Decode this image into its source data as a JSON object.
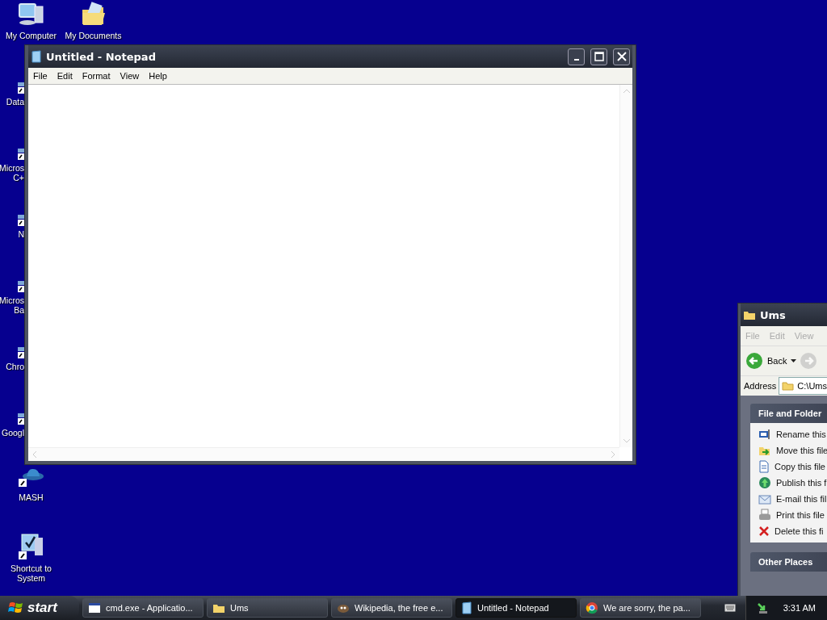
{
  "desktop": {
    "top_icons": [
      {
        "label": "My Computer",
        "kind": "computer"
      },
      {
        "label": "My Documents",
        "kind": "documents"
      }
    ],
    "side_icons": [
      {
        "lines": [
          "Data"
        ],
        "kind": "partial"
      },
      {
        "lines": [
          "Micros",
          "C+"
        ],
        "kind": "partial"
      },
      {
        "lines": [
          "N"
        ],
        "kind": "partial"
      },
      {
        "lines": [
          "Micros",
          "Ba"
        ],
        "kind": "partial"
      },
      {
        "lines": [
          "Chro"
        ],
        "kind": "partial"
      },
      {
        "lines": [
          "Googl"
        ],
        "kind": "partial"
      },
      {
        "lines": [
          "MASH"
        ],
        "kind": "hat"
      },
      {
        "lines": [
          "Shortcut to",
          "System"
        ],
        "kind": "system"
      }
    ]
  },
  "notepad": {
    "title": "Untitled - Notepad",
    "menu": [
      "File",
      "Edit",
      "Format",
      "View",
      "Help"
    ]
  },
  "explorer": {
    "title": "Ums",
    "menu": [
      "File",
      "Edit",
      "View"
    ],
    "toolbar": [
      {
        "label": "Back",
        "kind": "back",
        "disabled": false
      },
      {
        "kind": "forward",
        "disabled": true
      }
    ],
    "address_label": "Address",
    "address": "C:\\Ums",
    "panels": [
      {
        "title": "File and Folder",
        "tasks": [
          {
            "label": "Rename this",
            "kind": "rename"
          },
          {
            "label": "Move this file",
            "kind": "move"
          },
          {
            "label": "Copy this file",
            "kind": "copy"
          },
          {
            "label": "Publish this f",
            "kind": "publish"
          },
          {
            "label": "E-mail this fil",
            "kind": "email"
          },
          {
            "label": "Print this file",
            "kind": "print"
          },
          {
            "label": "Delete this fi",
            "kind": "delete"
          }
        ]
      },
      {
        "title": "Other Places"
      }
    ]
  },
  "taskbar": {
    "start": "start",
    "tasks": [
      {
        "label": "cmd.exe - Applicatio...",
        "kind": "cmd",
        "selected": false
      },
      {
        "label": "Ums",
        "kind": "folder",
        "selected": false
      },
      {
        "label": "Wikipedia, the free e...",
        "kind": "web",
        "selected": false
      },
      {
        "label": "Untitled - Notepad",
        "kind": "notepad",
        "selected": true
      },
      {
        "label": "We are sorry, the pa...",
        "kind": "chrome",
        "selected": false
      }
    ],
    "clock": "3:31 AM"
  }
}
